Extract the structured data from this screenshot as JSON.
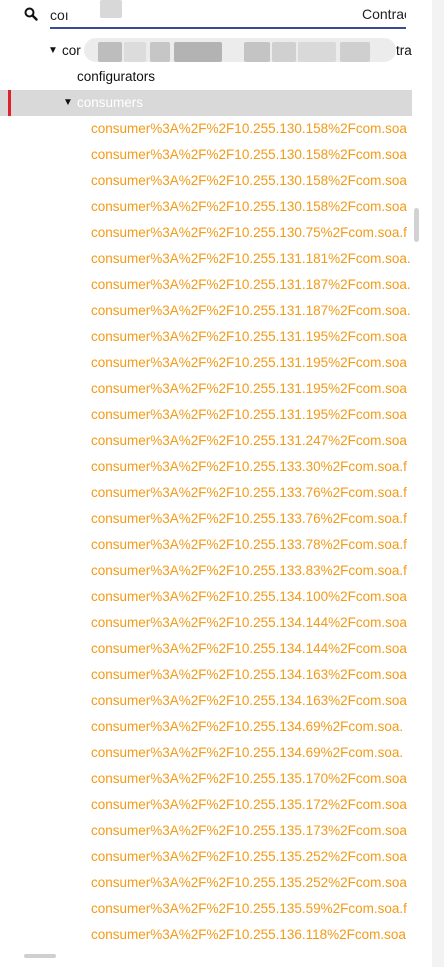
{
  "search": {
    "value": "coı",
    "suffix_text": "Contrac"
  },
  "tree": {
    "root_label": "cor",
    "root_suffix": "trac",
    "configurators_label": "configurators",
    "consumers_label": "consumers",
    "consumers": [
      "consumer%3A%2F%2F10.255.130.158%2Fcom.soa",
      "consumer%3A%2F%2F10.255.130.158%2Fcom.soa",
      "consumer%3A%2F%2F10.255.130.158%2Fcom.soa",
      "consumer%3A%2F%2F10.255.130.158%2Fcom.soa",
      "consumer%3A%2F%2F10.255.130.75%2Fcom.soa.f",
      "consumer%3A%2F%2F10.255.131.181%2Fcom.soa.",
      "consumer%3A%2F%2F10.255.131.187%2Fcom.soa.",
      "consumer%3A%2F%2F10.255.131.187%2Fcom.soa.",
      "consumer%3A%2F%2F10.255.131.195%2Fcom.soa",
      "consumer%3A%2F%2F10.255.131.195%2Fcom.soa",
      "consumer%3A%2F%2F10.255.131.195%2Fcom.soa",
      "consumer%3A%2F%2F10.255.131.195%2Fcom.soa",
      "consumer%3A%2F%2F10.255.131.247%2Fcom.soa",
      "consumer%3A%2F%2F10.255.133.30%2Fcom.soa.f",
      "consumer%3A%2F%2F10.255.133.76%2Fcom.soa.f",
      "consumer%3A%2F%2F10.255.133.76%2Fcom.soa.f",
      "consumer%3A%2F%2F10.255.133.78%2Fcom.soa.f",
      "consumer%3A%2F%2F10.255.133.83%2Fcom.soa.f",
      "consumer%3A%2F%2F10.255.134.100%2Fcom.soa",
      "consumer%3A%2F%2F10.255.134.144%2Fcom.soa",
      "consumer%3A%2F%2F10.255.134.144%2Fcom.soa",
      "consumer%3A%2F%2F10.255.134.163%2Fcom.soa",
      "consumer%3A%2F%2F10.255.134.163%2Fcom.soa",
      "consumer%3A%2F%2F10.255.134.69%2Fcom.soa.",
      "consumer%3A%2F%2F10.255.134.69%2Fcom.soa.",
      "consumer%3A%2F%2F10.255.135.170%2Fcom.soa",
      "consumer%3A%2F%2F10.255.135.172%2Fcom.soa",
      "consumer%3A%2F%2F10.255.135.173%2Fcom.soa",
      "consumer%3A%2F%2F10.255.135.252%2Fcom.soa",
      "consumer%3A%2F%2F10.255.135.252%2Fcom.soa",
      "consumer%3A%2F%2F10.255.135.59%2Fcom.soa.f",
      "consumer%3A%2F%2F10.255.136.118%2Fcom.soa"
    ]
  },
  "colors": {
    "accent_underline": "#3d4a93",
    "consumer_text": "#f39a18",
    "selection_marker": "#e0212d",
    "selected_row_bg": "#d9d9d9"
  },
  "icons": {
    "search": "search-icon",
    "expand": "caret-down-icon"
  }
}
